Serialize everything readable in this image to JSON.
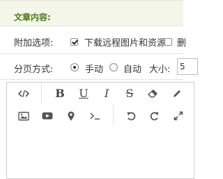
{
  "section": {
    "title": "文章内容:"
  },
  "options": {
    "label": "附加选项:",
    "download_remote_images": {
      "label": "下载远程图片和资源",
      "checked": true
    },
    "second_option": {
      "checked": false
    }
  },
  "paging": {
    "label": "分页方式:",
    "manual": {
      "label": "手动",
      "checked": true
    },
    "auto": {
      "label": "自动",
      "checked": false
    },
    "size_label": "大小:",
    "size_value": "5"
  },
  "editor": {
    "toolbar": {
      "row1": [
        {
          "name": "source-code-icon"
        },
        {
          "name": "bold-button",
          "text": "B"
        },
        {
          "name": "underline-button",
          "text": "U"
        },
        {
          "name": "italic-button",
          "text": "I"
        },
        {
          "name": "strikethrough-button",
          "text": "S"
        },
        {
          "name": "eraser-icon"
        },
        {
          "name": "pencil-icon"
        }
      ],
      "row2": [
        {
          "name": "image-icon"
        },
        {
          "name": "video-icon"
        },
        {
          "name": "map-pin-icon"
        },
        {
          "name": "code-block-icon"
        },
        {
          "name": "undo-icon"
        },
        {
          "name": "redo-icon"
        },
        {
          "name": "fullscreen-icon"
        }
      ]
    }
  }
}
